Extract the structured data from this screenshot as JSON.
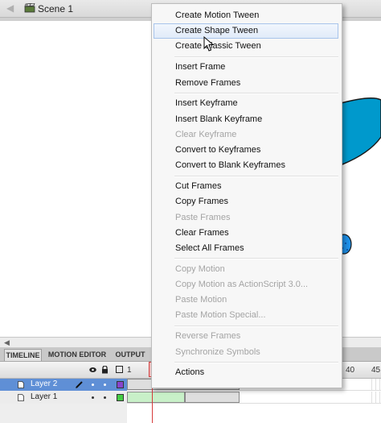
{
  "breadcrumb": {
    "back_icon": "back-arrow-icon",
    "scene_icon": "clapper-icon",
    "scene_label": "Scene 1"
  },
  "stage": {
    "shape_color": "#0099cc",
    "dotted_shape_color": "#1e90e8"
  },
  "tabs": [
    {
      "label": "TIMELINE",
      "active": true
    },
    {
      "label": "MOTION EDITOR",
      "active": false
    },
    {
      "label": "OUTPUT",
      "active": false
    }
  ],
  "timeline": {
    "frame_numbers": [
      "1",
      "40",
      "45"
    ],
    "layers": [
      {
        "name": "Layer 2",
        "selected": true,
        "color": "#8844cc"
      },
      {
        "name": "Layer 1",
        "selected": false,
        "color": "#44cc44"
      }
    ],
    "tween_color": "#c8f0c8",
    "playhead_color": "#d63a3a"
  },
  "context_menu": {
    "items": [
      {
        "label": "Create Motion Tween",
        "enabled": true
      },
      {
        "label": "Create Shape Tween",
        "enabled": true,
        "hover": true
      },
      {
        "label": "Create Classic Tween",
        "enabled": true
      },
      {
        "separator": true
      },
      {
        "label": "Insert Frame",
        "enabled": true
      },
      {
        "label": "Remove Frames",
        "enabled": true
      },
      {
        "separator": true
      },
      {
        "label": "Insert Keyframe",
        "enabled": true
      },
      {
        "label": "Insert Blank Keyframe",
        "enabled": true
      },
      {
        "label": "Clear Keyframe",
        "enabled": false
      },
      {
        "label": "Convert to Keyframes",
        "enabled": true
      },
      {
        "label": "Convert to Blank Keyframes",
        "enabled": true
      },
      {
        "separator": true
      },
      {
        "label": "Cut Frames",
        "enabled": true
      },
      {
        "label": "Copy Frames",
        "enabled": true
      },
      {
        "label": "Paste Frames",
        "enabled": false
      },
      {
        "label": "Clear Frames",
        "enabled": true
      },
      {
        "label": "Select All Frames",
        "enabled": true
      },
      {
        "separator": true
      },
      {
        "label": "Copy Motion",
        "enabled": false
      },
      {
        "label": "Copy Motion as ActionScript 3.0...",
        "enabled": false
      },
      {
        "label": "Paste Motion",
        "enabled": false
      },
      {
        "label": "Paste Motion Special...",
        "enabled": false
      },
      {
        "separator": true
      },
      {
        "label": "Reverse Frames",
        "enabled": false
      },
      {
        "label": "Synchronize Symbols",
        "enabled": false
      },
      {
        "separator": true
      },
      {
        "label": "Actions",
        "enabled": true
      }
    ]
  }
}
